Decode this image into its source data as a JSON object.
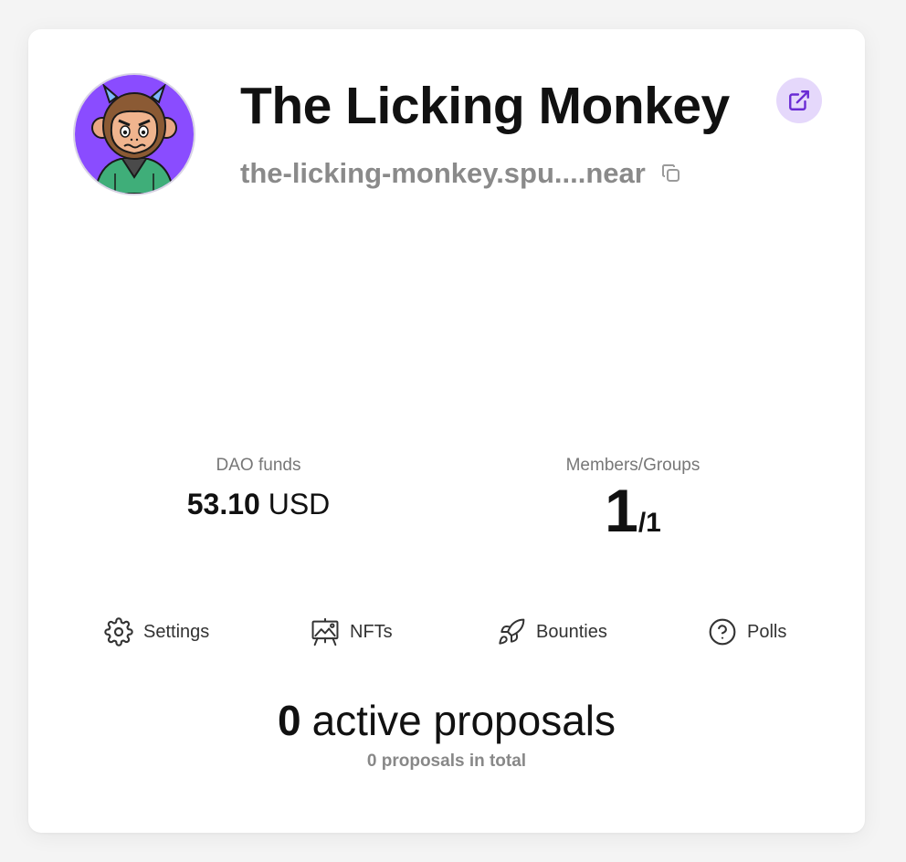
{
  "dao": {
    "name": "The Licking Monkey",
    "address": "the-licking-monkey.spu....near",
    "avatar_icon": "monkey-avatar",
    "accent_color": "#7b3fe4",
    "avatar_bg_color": "#8a4cff"
  },
  "stats": {
    "funds_label": "DAO funds",
    "funds_amount": "53.10",
    "funds_currency": "USD",
    "members_label": "Members/Groups",
    "members_count": "1",
    "groups_count": "/1"
  },
  "actions": {
    "settings": {
      "label": "Settings",
      "icon": "gear-icon"
    },
    "nfts": {
      "label": "NFTs",
      "icon": "easel-icon"
    },
    "bounties": {
      "label": "Bounties",
      "icon": "rocket-icon"
    },
    "polls": {
      "label": "Polls",
      "icon": "question-icon"
    }
  },
  "proposals": {
    "active_count": "0",
    "active_text": "active proposals",
    "total_text": "0 proposals in total"
  }
}
